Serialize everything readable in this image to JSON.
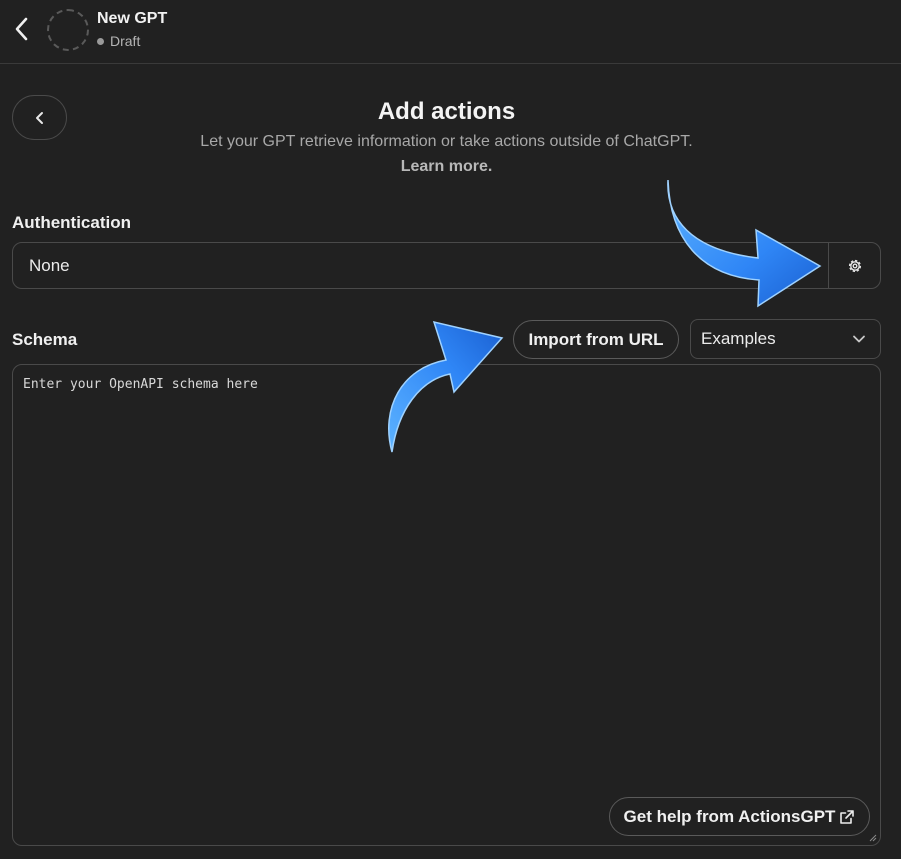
{
  "header": {
    "gpt_name": "New GPT",
    "status": "Draft"
  },
  "page": {
    "title": "Add actions",
    "subtitle": "Let your GPT retrieve information or take actions outside of ChatGPT.",
    "learn_more": "Learn more."
  },
  "authentication": {
    "label": "Authentication",
    "value": "None"
  },
  "schema": {
    "label": "Schema",
    "import_button": "Import from URL",
    "examples_select": "Examples",
    "placeholder": "Enter your OpenAPI schema here",
    "help_button": "Get help from ActionsGPT"
  },
  "icons": {
    "back": "chevron-left-icon",
    "settings": "gear-icon",
    "dropdown": "chevron-down-icon",
    "external": "external-link-icon"
  },
  "colors": {
    "background": "#212121",
    "border": "#4a4a4a",
    "annotation_arrow": "#2f86f6"
  }
}
